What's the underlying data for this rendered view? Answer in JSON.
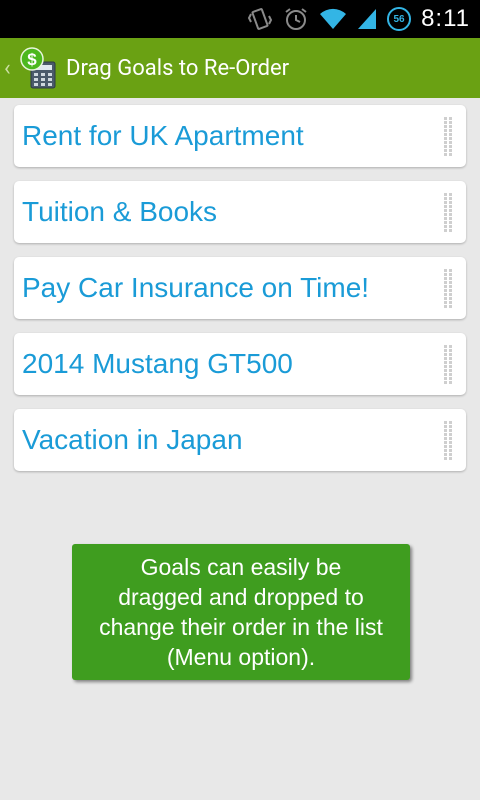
{
  "status_bar": {
    "time": "8:11",
    "battery_level": "56",
    "icons": [
      "vibrate-icon",
      "alarm-icon",
      "wifi-icon",
      "cell-signal-icon",
      "battery-icon"
    ]
  },
  "action_bar": {
    "title": "Drag Goals to Re-Order",
    "app_icon": "dollar-calculator-icon",
    "background_color": "#6aa113"
  },
  "goals": [
    {
      "label": "Rent for UK Apartment"
    },
    {
      "label": "Tuition & Books"
    },
    {
      "label": "Pay Car Insurance on Time!"
    },
    {
      "label": "2014 Mustang GT500"
    },
    {
      "label": "Vacation in Japan"
    }
  ],
  "hint": {
    "lines": [
      "Goals can easily be",
      "dragged and dropped to",
      "change their order in the list",
      "(Menu option)."
    ],
    "background_color": "#3f9d1f"
  },
  "colors": {
    "goal_text": "#1a9bd7",
    "page_background": "#e8e8e8"
  }
}
